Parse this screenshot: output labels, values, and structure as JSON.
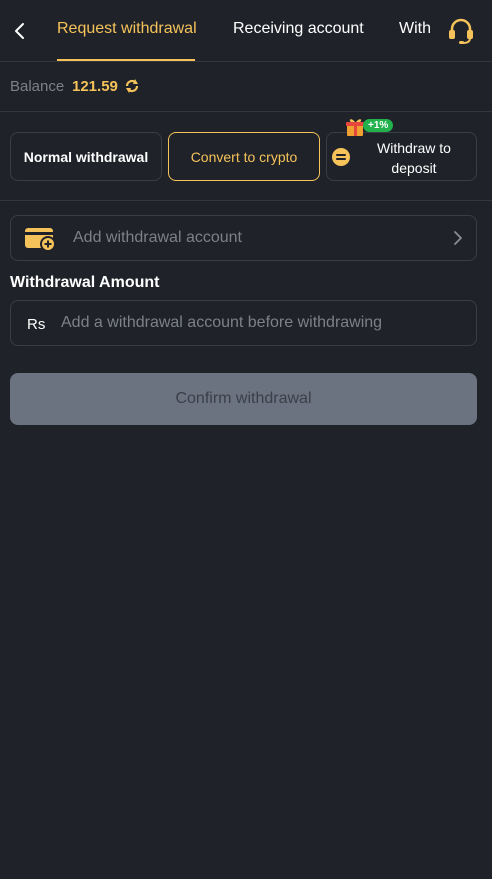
{
  "header": {
    "tabs": [
      {
        "label": "Request withdrawal",
        "active": true
      },
      {
        "label": "Receiving account",
        "active": false
      },
      {
        "label": "With",
        "active": false
      }
    ],
    "icons": {
      "back": "chevron-left-icon",
      "support": "headset-icon"
    }
  },
  "balance": {
    "label": "Balance",
    "value": "121.59",
    "refresh_icon": "refresh-icon"
  },
  "methods": {
    "normal": "Normal withdrawal",
    "crypto": "Convert to crypto",
    "deposit": "Withdraw to deposit",
    "promo_badge": "+1%",
    "selected": "crypto"
  },
  "account": {
    "add_label": "Add withdrawal account",
    "icon": "wallet-add-icon",
    "chevron": "chevron-right-icon"
  },
  "amount": {
    "title": "Withdrawal Amount",
    "currency": "Rs",
    "placeholder": "Add a withdrawal account before withdrawing"
  },
  "confirm": {
    "label": "Confirm withdrawal"
  },
  "colors": {
    "background": "#1f2229",
    "accent": "#f5c35a",
    "muted_text": "#7d8089",
    "border": "#3a3d44",
    "disabled_button": "#6b7380",
    "promo_green": "#22b14c"
  }
}
